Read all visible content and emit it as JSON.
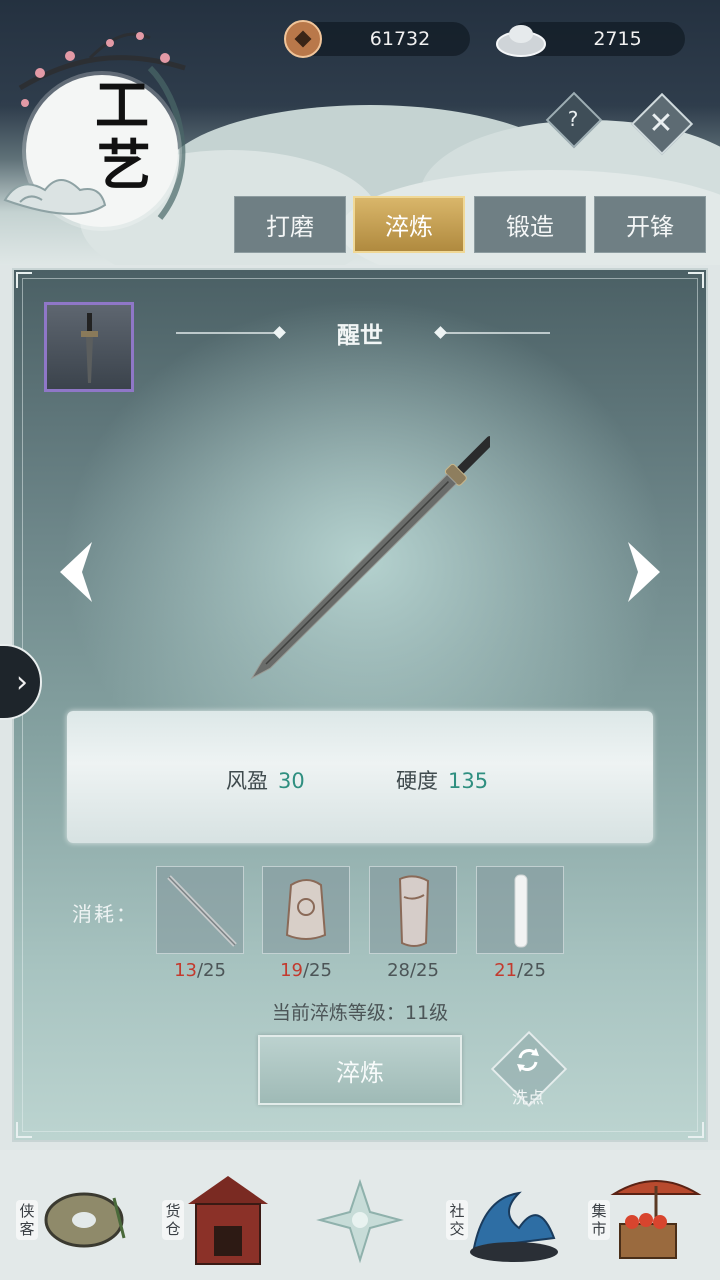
{
  "header": {
    "title_chars": [
      "工",
      "艺"
    ],
    "currencies": [
      {
        "icon": "copper-coin-icon",
        "value": "61732"
      },
      {
        "icon": "silver-ingot-icon",
        "value": "2715"
      }
    ],
    "help_label": "?",
    "close_label": "✕"
  },
  "tabs": [
    {
      "label": "打磨",
      "active": false
    },
    {
      "label": "淬炼",
      "active": true
    },
    {
      "label": "锻造",
      "active": false
    },
    {
      "label": "开锋",
      "active": false
    }
  ],
  "item": {
    "name": "醒世",
    "stats": [
      {
        "label": "风盈",
        "value": "30"
      },
      {
        "label": "硬度",
        "value": "135"
      }
    ]
  },
  "consume": {
    "label": "消耗：",
    "materials": [
      {
        "icon": "iron-rod-icon",
        "have": "13",
        "need": "/25",
        "short": true
      },
      {
        "icon": "armor-piece-icon",
        "have": "19",
        "need": "/25",
        "short": true
      },
      {
        "icon": "bracer-icon",
        "have": "28",
        "need": "/25",
        "short": false
      },
      {
        "icon": "jade-bar-icon",
        "have": "21",
        "need": "/25",
        "short": true
      }
    ]
  },
  "level_text": "当前淬炼等级：11级",
  "actions": {
    "refine_label": "淬炼",
    "reset_label": "洗点"
  },
  "side_tab_glyph": "›",
  "bottom_nav": [
    {
      "label": "侠客",
      "icon": "hero-icon"
    },
    {
      "label": "货仓",
      "icon": "warehouse-icon"
    },
    {
      "label": "",
      "icon": "compass-flower-icon"
    },
    {
      "label": "社交",
      "icon": "wave-social-icon"
    },
    {
      "label": "集市",
      "icon": "market-icon"
    }
  ],
  "colors": {
    "accent_gold": "#d4b062",
    "value_green": "#2f8f80",
    "shortage_red": "#c33a2e"
  }
}
